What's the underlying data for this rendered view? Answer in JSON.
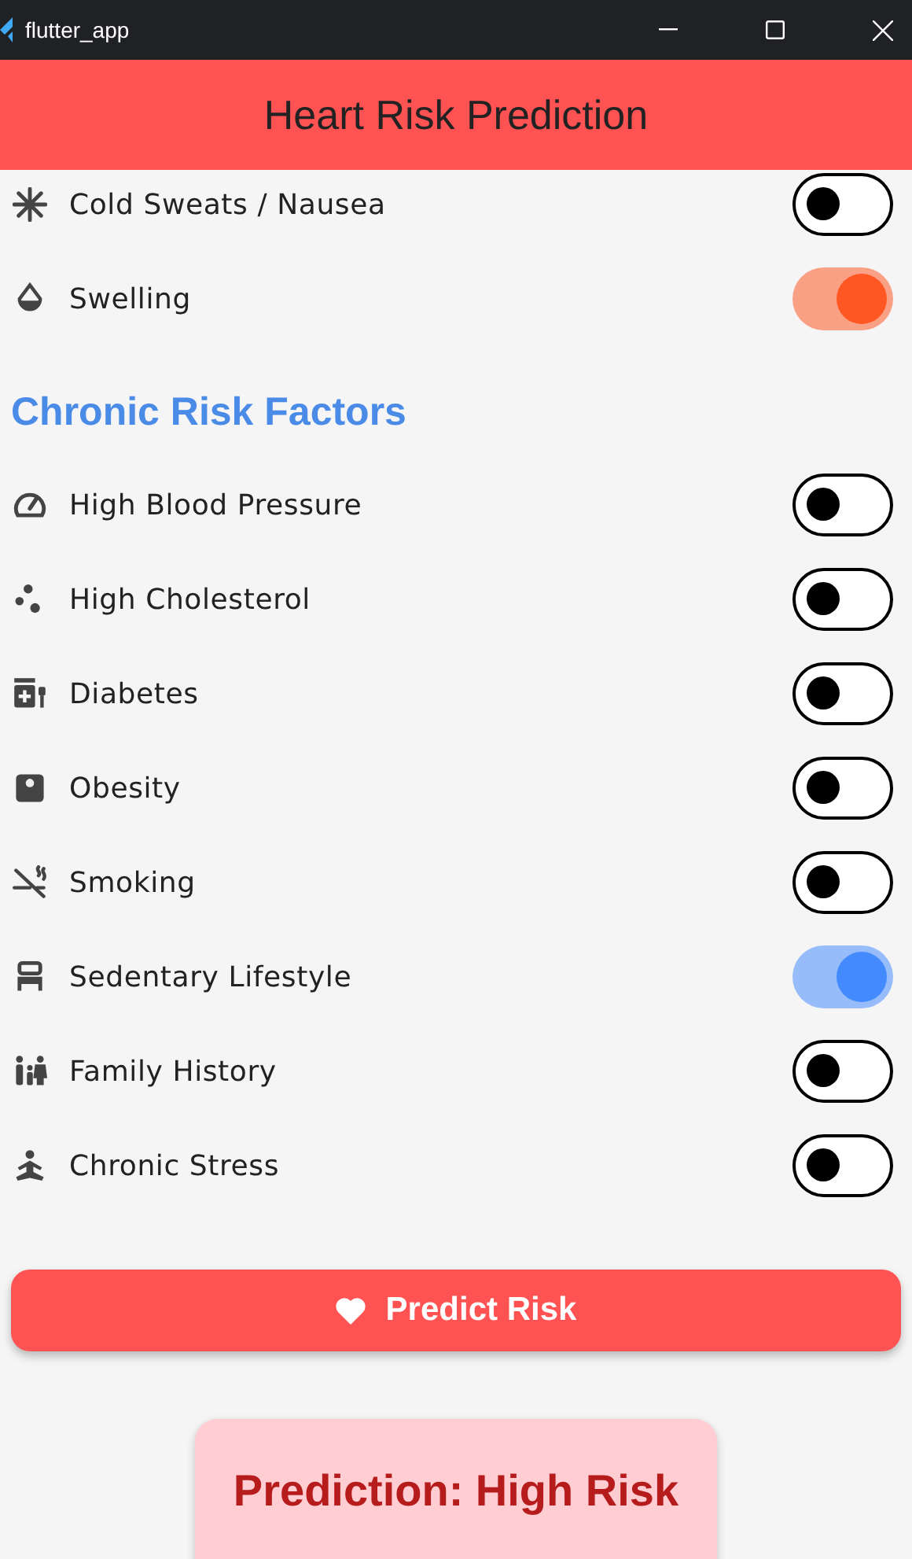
{
  "window": {
    "title": "flutter_app"
  },
  "app_bar": {
    "title": "Heart Risk Prediction"
  },
  "sections": [
    {
      "items": [
        {
          "label": "Cold Sweats / Nausea",
          "on": false
        },
        {
          "label": "Swelling",
          "on": true,
          "color": "#ff5722"
        }
      ]
    },
    {
      "heading": "Chronic Risk Factors",
      "items": [
        {
          "label": "High Blood Pressure",
          "on": false
        },
        {
          "label": "High Cholesterol",
          "on": false
        },
        {
          "label": "Diabetes",
          "on": false
        },
        {
          "label": "Obesity",
          "on": false
        },
        {
          "label": "Smoking",
          "on": false
        },
        {
          "label": "Sedentary Lifestyle",
          "on": true,
          "color": "#448aff"
        },
        {
          "label": "Family History",
          "on": false
        },
        {
          "label": "Chronic Stress",
          "on": false
        }
      ]
    }
  ],
  "predict_button": {
    "label": "Predict Risk"
  },
  "result": {
    "text": "Prediction: High Risk"
  }
}
